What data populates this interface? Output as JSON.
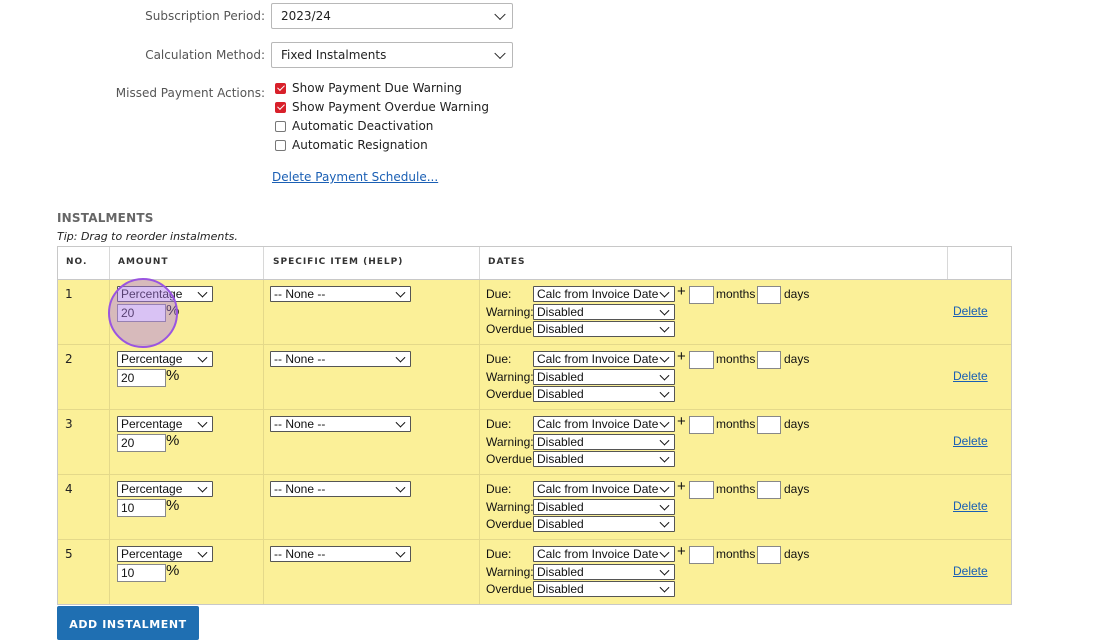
{
  "form": {
    "subscription_period": {
      "label": "Subscription Period:",
      "value": "2023/24"
    },
    "calculation_method": {
      "label": "Calculation Method:",
      "value": "Fixed Instalments"
    },
    "missed_payment": {
      "label": "Missed Payment Actions:",
      "options": [
        {
          "label": "Show Payment Due Warning",
          "checked": true
        },
        {
          "label": "Show Payment Overdue Warning",
          "checked": true
        },
        {
          "label": "Automatic Deactivation",
          "checked": false
        },
        {
          "label": "Automatic Resignation",
          "checked": false
        }
      ]
    },
    "delete_schedule_link": "Delete Payment Schedule..."
  },
  "instalments": {
    "title": "INSTALMENTS",
    "tip": "Tip: Drag to reorder instalments.",
    "headers": {
      "no": "NO.",
      "amount": "AMOUNT",
      "specific_item": "SPECIFIC ITEM (HELP)",
      "dates": "DATES"
    },
    "row_labels": {
      "due": "Due:",
      "warning": "Warning:",
      "overdue": "Overdue:",
      "months": "months",
      "days": "days",
      "plus": "+",
      "percent": "%",
      "delete": "Delete"
    },
    "rows": [
      {
        "no": "1",
        "amount_type": "Percentage",
        "amount": "20",
        "specific_item": "-- None --",
        "due": "Calc from Invoice Date",
        "warning": "Disabled",
        "overdue": "Disabled"
      },
      {
        "no": "2",
        "amount_type": "Percentage",
        "amount": "20",
        "specific_item": "-- None --",
        "due": "Calc from Invoice Date",
        "warning": "Disabled",
        "overdue": "Disabled"
      },
      {
        "no": "3",
        "amount_type": "Percentage",
        "amount": "20",
        "specific_item": "-- None --",
        "due": "Calc from Invoice Date",
        "warning": "Disabled",
        "overdue": "Disabled"
      },
      {
        "no": "4",
        "amount_type": "Percentage",
        "amount": "10",
        "specific_item": "-- None --",
        "due": "Calc from Invoice Date",
        "warning": "Disabled",
        "overdue": "Disabled"
      },
      {
        "no": "5",
        "amount_type": "Percentage",
        "amount": "10",
        "specific_item": "-- None --",
        "due": "Calc from Invoice Date",
        "warning": "Disabled",
        "overdue": "Disabled"
      }
    ],
    "add_button": "ADD INSTALMENT"
  },
  "colors": {
    "row_bg": "#fbf098",
    "link": "#1a5fb4",
    "button": "#1f6fb2",
    "checkbox": "#d8202a",
    "focus": "#9a55e0"
  }
}
